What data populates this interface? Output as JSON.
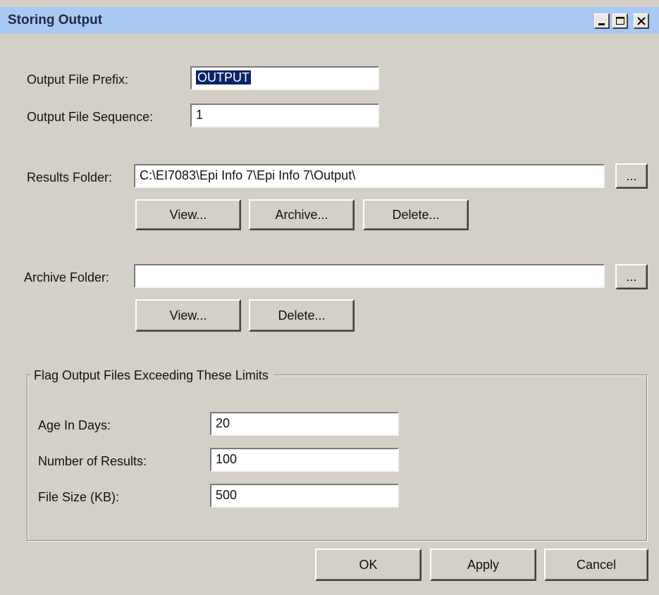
{
  "window": {
    "title": "Storing Output",
    "controls": [
      "minimize-icon",
      "maximize-icon",
      "close-icon"
    ]
  },
  "output": {
    "prefix_label": "Output File Prefix:",
    "prefix_value": "OUTPUT",
    "sequence_label": "Output File Sequence:",
    "sequence_value": "1"
  },
  "results": {
    "label": "Results Folder:",
    "path": "C:\\EI7083\\Epi Info 7\\Epi Info 7\\Output\\",
    "browse_label": "...",
    "view_label": "View...",
    "archive_label": "Archive...",
    "delete_label": "Delete..."
  },
  "archive": {
    "label": "Archive Folder:",
    "path": "",
    "browse_label": "...",
    "view_label": "View...",
    "delete_label": "Delete..."
  },
  "limits": {
    "group_title": "Flag Output Files Exceeding These Limits",
    "age_label": "Age In Days:",
    "age_value": "20",
    "results_label": "Number of Results:",
    "results_value": "100",
    "size_label": "File Size (KB):",
    "size_value": "500"
  },
  "footer": {
    "ok_label": "OK",
    "apply_label": "Apply",
    "cancel_label": "Cancel"
  }
}
